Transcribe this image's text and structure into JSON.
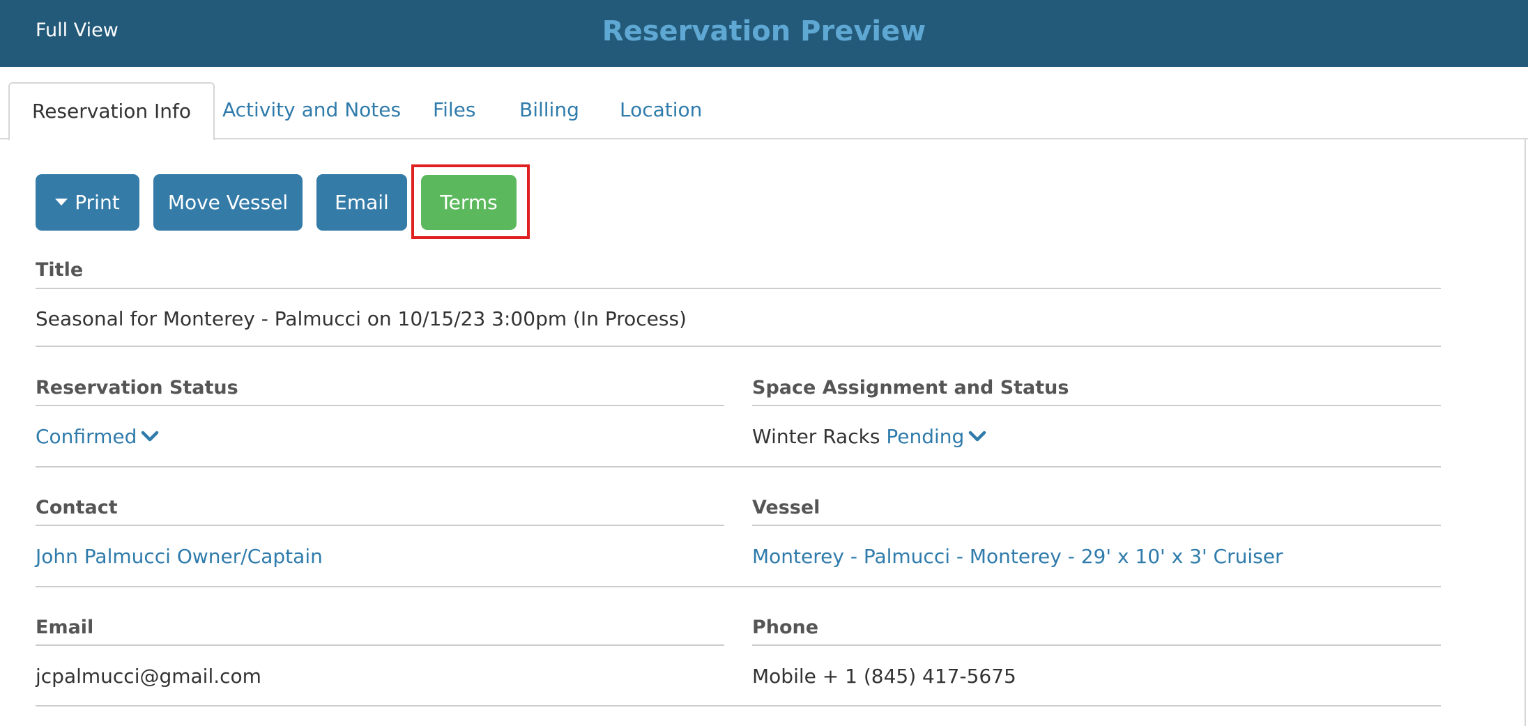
{
  "header": {
    "full_view": "Full View",
    "title": "Reservation Preview"
  },
  "tabs": [
    {
      "label": "Reservation Info",
      "active": true
    },
    {
      "label": "Activity and Notes"
    },
    {
      "label": "Files"
    },
    {
      "label": "Billing"
    },
    {
      "label": "Location"
    }
  ],
  "toolbar": {
    "print_label": "Print",
    "move_vessel_label": "Move Vessel",
    "email_label": "Email",
    "terms_label": "Terms"
  },
  "fields": {
    "title_label": "Title",
    "title_value": "Seasonal for Monterey - Palmucci on 10/15/23 3:00pm (In Process)",
    "status_label": "Reservation Status",
    "status_value": "Confirmed",
    "space_label": "Space Assignment and Status",
    "space_name": "Winter Racks",
    "space_status": "Pending",
    "contact_label": "Contact",
    "contact_value": "John Palmucci Owner/Captain",
    "vessel_label": "Vessel",
    "vessel_value": "Monterey - Palmucci - Monterey - 29' x 10' x 3' Cruiser",
    "email_label": "Email",
    "email_value": "jcpalmucci@gmail.com",
    "phone_label": "Phone",
    "phone_value": "Mobile + 1 (845) 417-5675"
  },
  "colors": {
    "header_bg": "#235a7a",
    "header_title": "#5fa8d3",
    "link": "#2f7bab",
    "primary_button": "#347ba8",
    "success_button": "#5cb85c",
    "highlight_box": "#e02020"
  }
}
